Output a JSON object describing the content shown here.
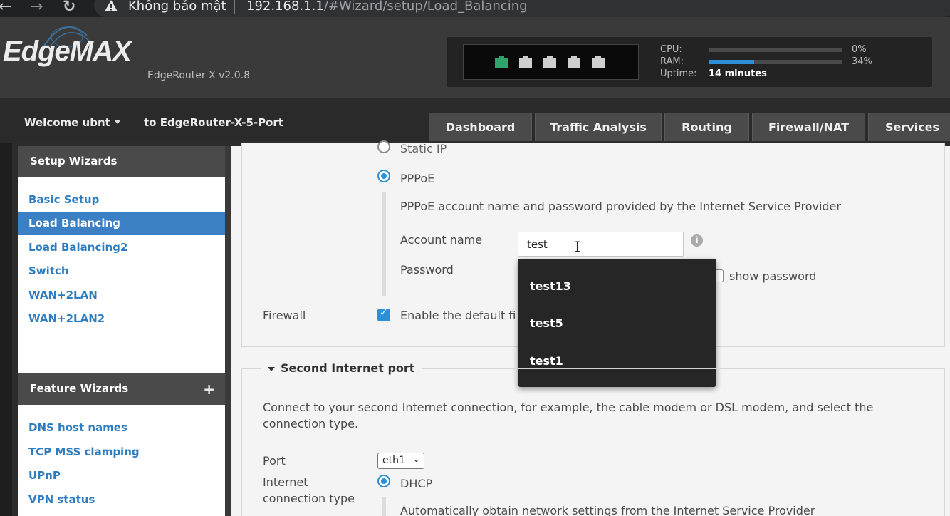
{
  "browser": {
    "back_glyph": "←",
    "forward_glyph": "→",
    "reload_glyph": "↻",
    "security_icon": "warning-triangle-icon",
    "security_text": "Không bảo mật",
    "url_host": "192.168.1.1",
    "url_path": "/#Wizard/setup/Load_Balancing"
  },
  "header": {
    "logo": "EdgeMAX",
    "model": "EdgeRouter X v2.0.8",
    "ports": [
      {
        "name": "eth0",
        "active": true
      },
      {
        "name": "eth1",
        "active": false
      },
      {
        "name": "eth2",
        "active": false
      },
      {
        "name": "eth3",
        "active": false
      },
      {
        "name": "eth4",
        "active": false
      }
    ],
    "cpu_label": "CPU:",
    "cpu_value": "0%",
    "cpu_fraction": 0.0,
    "ram_label": "RAM:",
    "ram_value": "34%",
    "ram_fraction": 0.34,
    "uptime_label": "Uptime:",
    "uptime_value": "14 minutes"
  },
  "nav": {
    "welcome": "Welcome ubnt",
    "router": "to EdgeRouter-X-5-Port",
    "tabs": [
      "Dashboard",
      "Traffic Analysis",
      "Routing",
      "Firewall/NAT",
      "Services"
    ]
  },
  "sidebar": {
    "setup_title": "Setup Wizards",
    "setup_items": [
      "Basic Setup",
      "Load Balancing",
      "Load Balancing2",
      "Switch",
      "WAN+2LAN",
      "WAN+2LAN2"
    ],
    "active_index": 1,
    "feature_title": "Feature Wizards",
    "feature_plus": "+",
    "feature_items": [
      "DNS host names",
      "TCP MSS clamping",
      "UPnP",
      "VPN status"
    ]
  },
  "form": {
    "static_ip_label": "Static IP",
    "pppoe_label": "PPPoE",
    "pppoe_desc": "PPPoE account name and password provided by the Internet Service Provider",
    "account_label": "Account name",
    "account_value": "test",
    "password_label": "Password",
    "show_password": "show password",
    "firewall_label": "Firewall",
    "firewall_text": "Enable the default fi",
    "info_glyph": "i",
    "cursor_glyph": "I"
  },
  "autocomplete": [
    "test13",
    "test5",
    "test1"
  ],
  "second_port": {
    "title": "Second Internet port",
    "desc_line1": "Connect to your second Internet connection, for example, the cable modem or DSL modem, and select the",
    "desc_line2": "connection type.",
    "port_label": "Port",
    "port_value": "eth1",
    "port_chevron": "⌄",
    "conn_label_line1": "Internet",
    "conn_label_line2": "connection type",
    "dhcp_label": "DHCP",
    "dhcp_desc": "Automatically obtain network settings from the Internet Service Provider"
  },
  "colors": {
    "accent": "#2d8fd8",
    "link": "#2e7dc0",
    "active_port": "#2fa36b"
  }
}
